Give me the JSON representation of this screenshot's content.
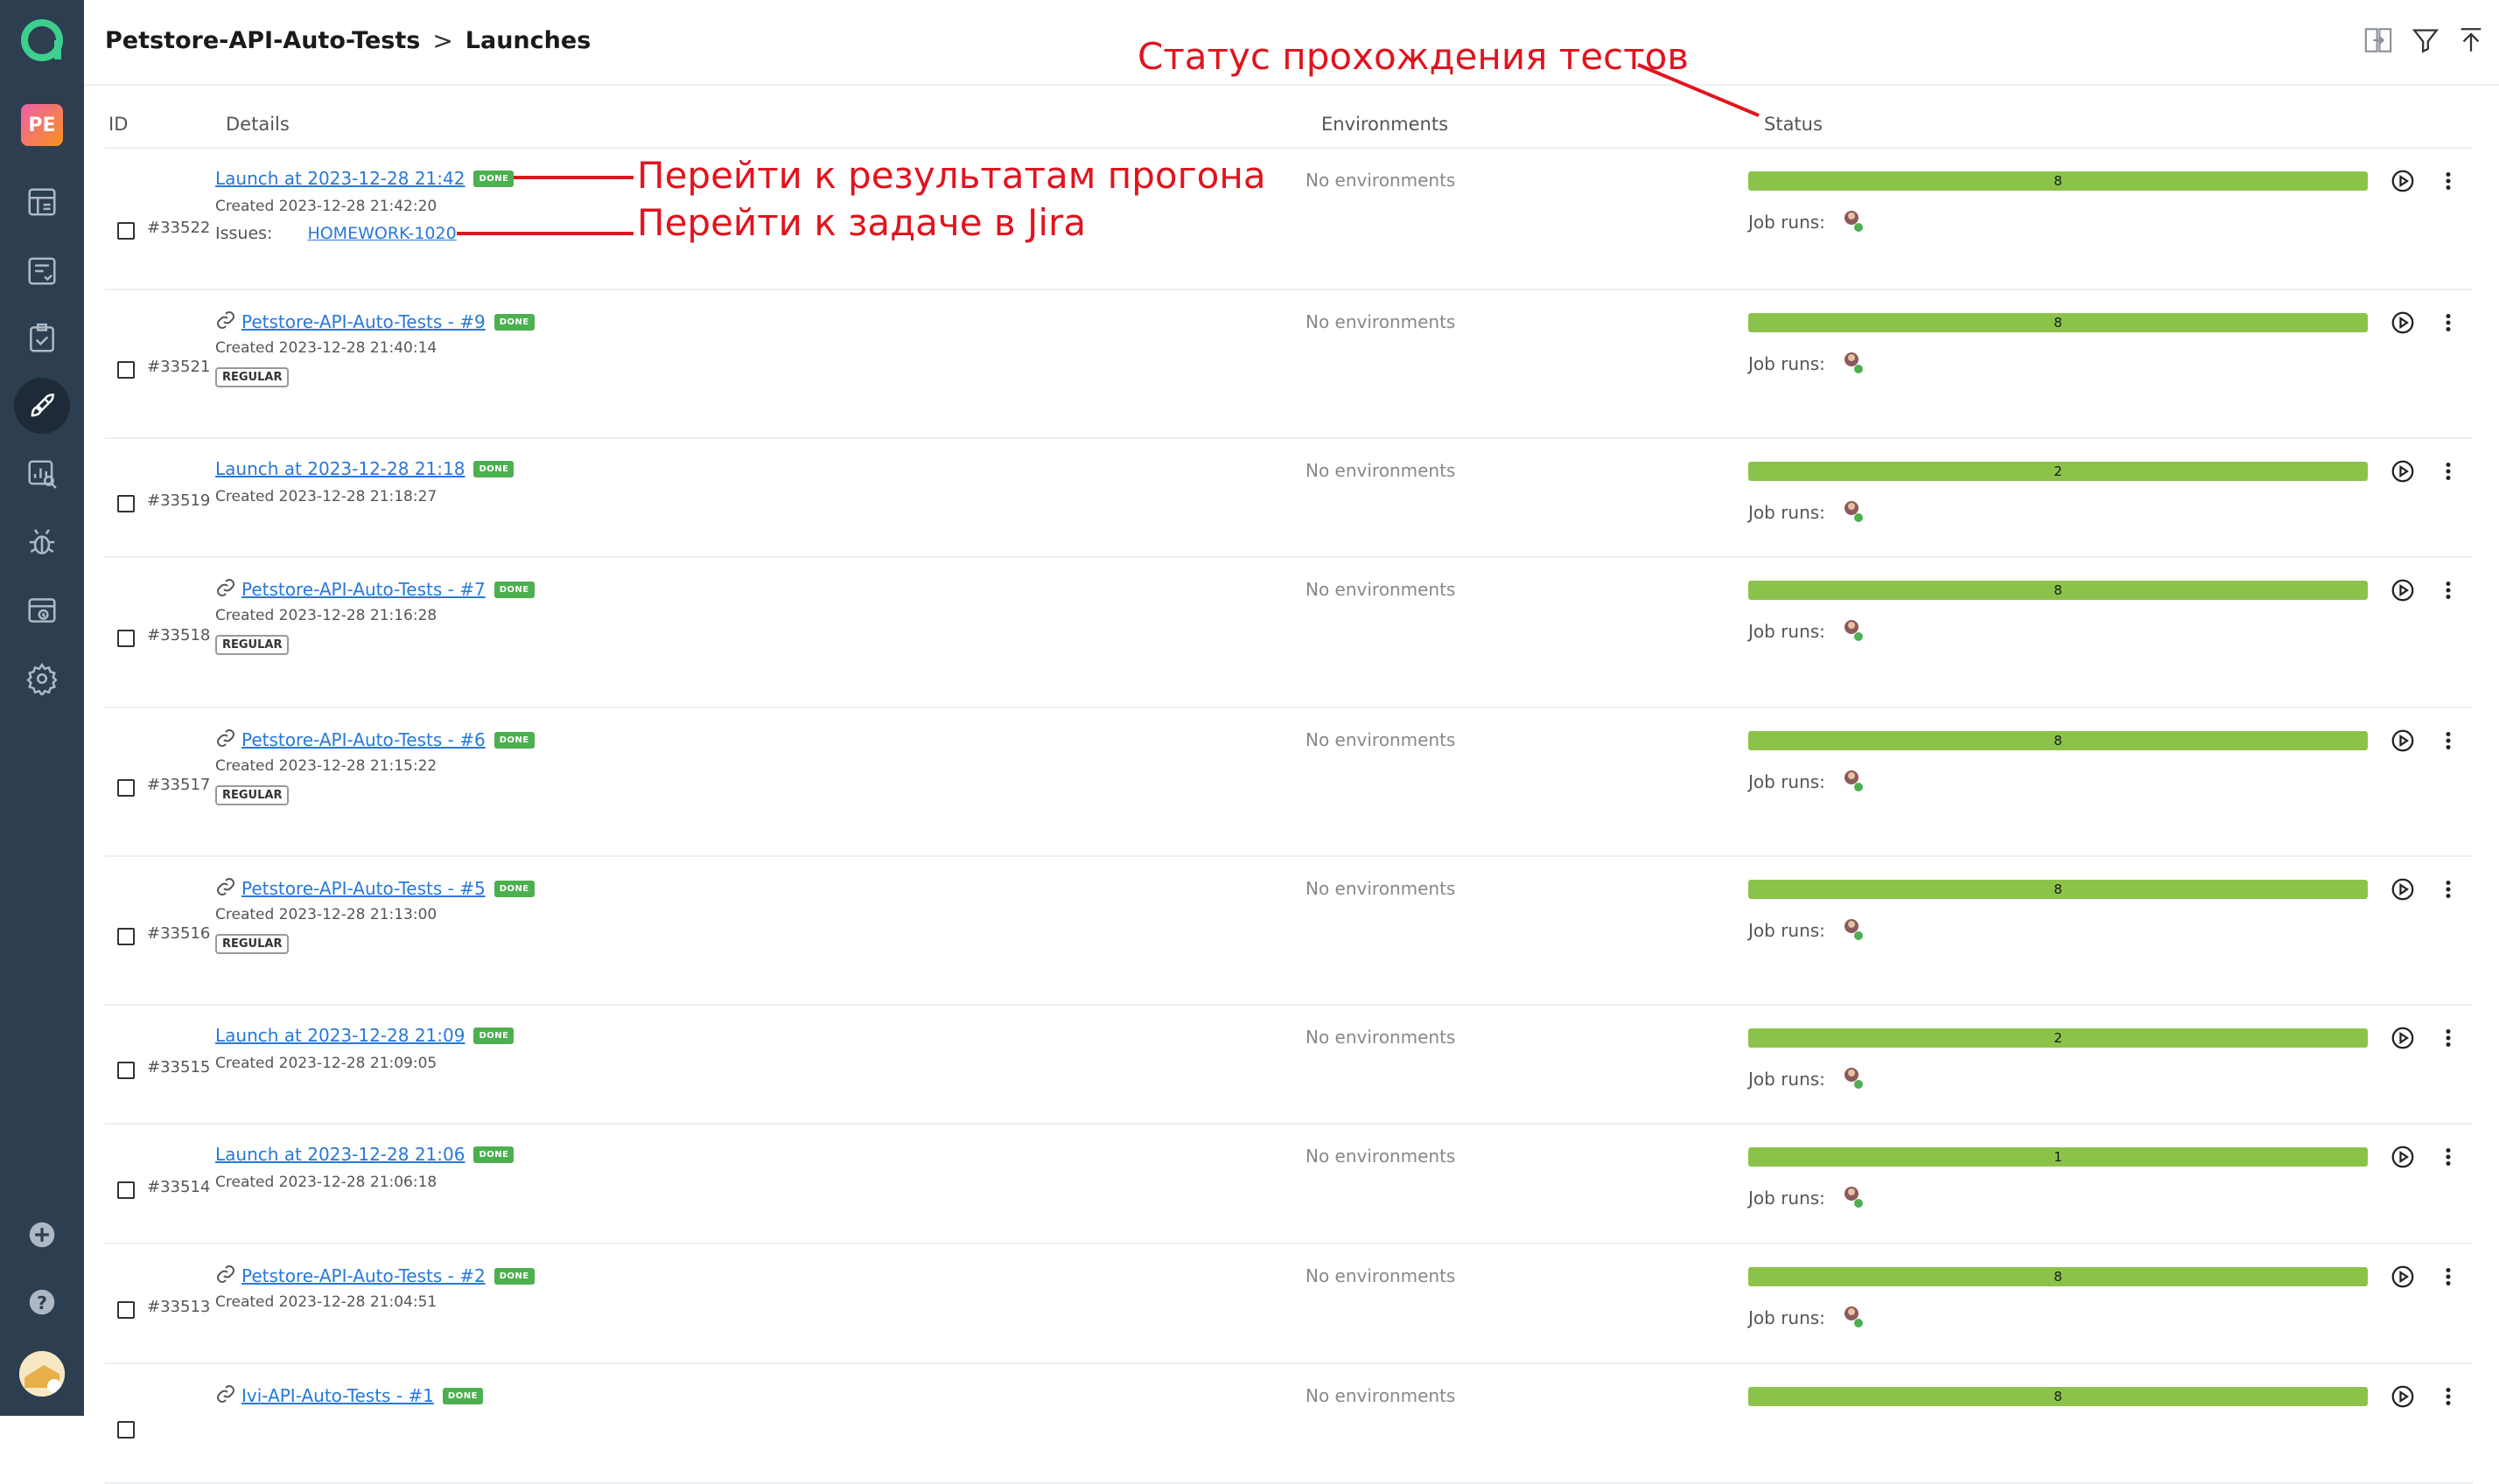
{
  "sidebar": {
    "project_initials": "PE",
    "items": [
      {
        "name": "dashboards-icon"
      },
      {
        "name": "test-cases-icon"
      },
      {
        "name": "test-plans-icon"
      },
      {
        "name": "launches-icon"
      },
      {
        "name": "analytics-icon"
      },
      {
        "name": "defects-icon"
      },
      {
        "name": "jobs-icon"
      },
      {
        "name": "settings-icon"
      }
    ],
    "bottom": [
      {
        "name": "add-icon"
      },
      {
        "name": "help-icon"
      }
    ]
  },
  "header": {
    "project": "Petstore-API-Auto-Tests",
    "separator": ">",
    "page": "Launches"
  },
  "annotations": {
    "status": "Статус прохождения тестов",
    "results": "Перейти к результатам прогона",
    "jira": "Перейти к задаче в Jira"
  },
  "columns": {
    "id": "ID",
    "details": "Details",
    "environments": "Environments",
    "status": "Status"
  },
  "rows": [
    {
      "id": "#33522",
      "title": "Launch at 2023-12-28 21:42",
      "linked": false,
      "badge": "DONE",
      "created": "Created 2023-12-28 21:42:20",
      "tag": "",
      "issues_label": "Issues:",
      "issue": "HOMEWORK-1020",
      "env": "No environments",
      "count": "8",
      "jobruns": "Job runs:"
    },
    {
      "id": "#33521",
      "title": "Petstore-API-Auto-Tests - #9",
      "linked": true,
      "badge": "DONE",
      "created": "Created 2023-12-28 21:40:14",
      "tag": "REGULAR",
      "env": "No environments",
      "count": "8",
      "jobruns": "Job runs:"
    },
    {
      "id": "#33519",
      "title": "Launch at 2023-12-28 21:18",
      "linked": false,
      "badge": "DONE",
      "created": "Created 2023-12-28 21:18:27",
      "tag": "",
      "env": "No environments",
      "count": "2",
      "jobruns": "Job runs:"
    },
    {
      "id": "#33518",
      "title": "Petstore-API-Auto-Tests - #7",
      "linked": true,
      "badge": "DONE",
      "created": "Created 2023-12-28 21:16:28",
      "tag": "REGULAR",
      "env": "No environments",
      "count": "8",
      "jobruns": "Job runs:"
    },
    {
      "id": "#33517",
      "title": "Petstore-API-Auto-Tests - #6",
      "linked": true,
      "badge": "DONE",
      "created": "Created 2023-12-28 21:15:22",
      "tag": "REGULAR",
      "env": "No environments",
      "count": "8",
      "jobruns": "Job runs:"
    },
    {
      "id": "#33516",
      "title": "Petstore-API-Auto-Tests - #5",
      "linked": true,
      "badge": "DONE",
      "created": "Created 2023-12-28 21:13:00",
      "tag": "REGULAR",
      "env": "No environments",
      "count": "8",
      "jobruns": "Job runs:"
    },
    {
      "id": "#33515",
      "title": "Launch at 2023-12-28 21:09",
      "linked": false,
      "badge": "DONE",
      "created": "Created 2023-12-28 21:09:05",
      "tag": "",
      "env": "No environments",
      "count": "2",
      "jobruns": "Job runs:"
    },
    {
      "id": "#33514",
      "title": "Launch at 2023-12-28 21:06",
      "linked": false,
      "badge": "DONE",
      "created": "Created 2023-12-28 21:06:18",
      "tag": "",
      "env": "No environments",
      "count": "1",
      "jobruns": "Job runs:"
    },
    {
      "id": "#33513",
      "title": "Petstore-API-Auto-Tests - #2",
      "linked": true,
      "badge": "DONE",
      "created": "Created 2023-12-28 21:04:51",
      "tag": "",
      "env": "No environments",
      "count": "8",
      "jobruns": "Job runs:"
    },
    {
      "id": "",
      "title": "Ivi-API-Auto-Tests - #1",
      "linked": true,
      "badge": "DONE",
      "created": "",
      "tag": "",
      "env": "No environments",
      "count": "8",
      "jobruns": ""
    }
  ],
  "colors": {
    "accent": "#2878d9",
    "done": "#4caf50",
    "bar": "#8bc34a",
    "annotation": "#e0141e",
    "sidebar": "#2c3e50"
  }
}
